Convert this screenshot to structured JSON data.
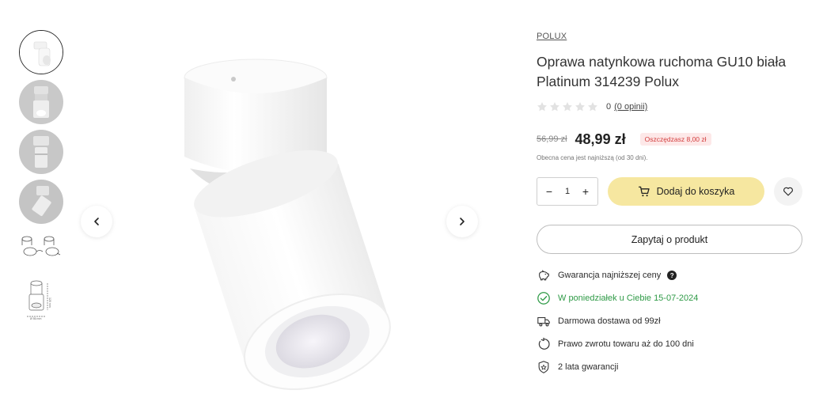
{
  "gallery": {
    "thumbnails": [
      {
        "name": "thumb-1",
        "active": true
      },
      {
        "name": "thumb-2",
        "active": false
      },
      {
        "name": "thumb-3",
        "active": false
      },
      {
        "name": "thumb-4",
        "active": false
      },
      {
        "name": "thumb-5",
        "active": false
      },
      {
        "name": "thumb-6",
        "active": false
      }
    ],
    "dimension_labels": {
      "height": "120 mm",
      "diameter": "Ø 56 mm"
    },
    "prev_icon": "chevron-left-icon",
    "next_icon": "chevron-right-icon"
  },
  "product": {
    "brand": "POLUX",
    "title": "Oprawa natynkowa ruchoma GU10 biała Platinum 314239 Polux",
    "rating": {
      "stars": 0,
      "max_stars": 5,
      "value": "0",
      "reviews_link": "(0 opinii)"
    },
    "price": {
      "old": "56,99 zł",
      "current": "48,99 zł",
      "saving": "Oszczędzasz 8,00 zł",
      "note": "Obecna cena jest najniższą (od 30 dni)."
    },
    "quantity": {
      "minus": "−",
      "value": "1",
      "plus": "+"
    },
    "add_to_cart": "Dodaj do koszyka",
    "ask": "Zapytaj o produkt"
  },
  "features": [
    {
      "icon": "piggy-bank-icon",
      "text": "Gwarancja najniższej ceny",
      "has_help": true,
      "help": "?"
    },
    {
      "icon": "check-circle-icon",
      "text": "W poniedziałek u Ciebie 15-07-2024",
      "highlight": true
    },
    {
      "icon": "truck-icon",
      "text": "Darmowa dostawa od 99zł"
    },
    {
      "icon": "return-icon",
      "text": "Prawo zwrotu towaru aż do 100 dni"
    },
    {
      "icon": "shield-icon",
      "text": "2 lata gwarancji"
    }
  ],
  "colors": {
    "accent_button": "#f6e7a0",
    "success_text": "#2e9a46",
    "saving_text": "#d33d3d",
    "saving_bg": "#fde8e8"
  }
}
